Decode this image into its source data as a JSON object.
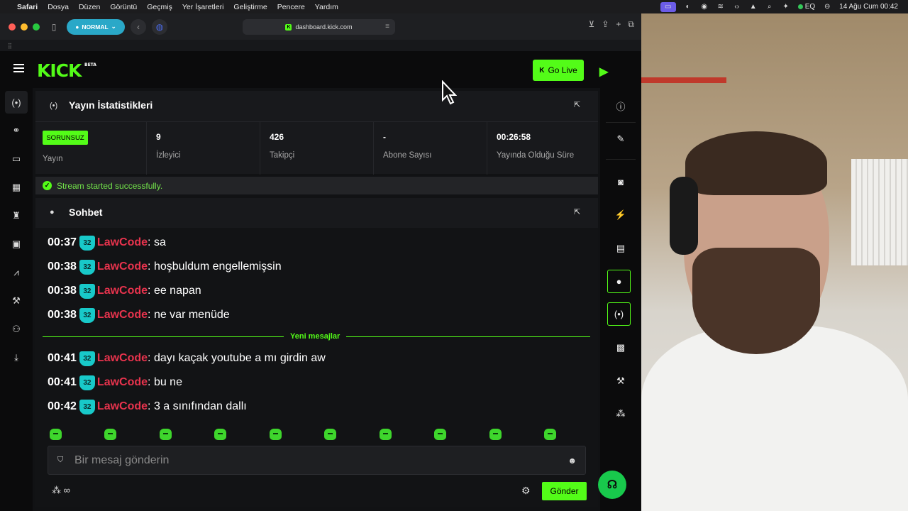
{
  "menubar": {
    "app": "Safari",
    "items": [
      "Dosya",
      "Düzen",
      "Görüntü",
      "Geçmiş",
      "Yer İşaretleri",
      "Geliştirme",
      "Pencere",
      "Yardım"
    ],
    "eq_label": "EQ",
    "datetime": "14 Ağu Cum  00:42"
  },
  "browser": {
    "profile_label": "NORMAL",
    "url": "dashboard.kick.com"
  },
  "header": {
    "logo_text": "KICK",
    "logo_badge": "BETA",
    "go_live_label": "Go Live"
  },
  "stream_stats": {
    "title": "Yayın İstatistikleri",
    "status_badge": "SORUNSUZ",
    "status_label": "Yayın",
    "viewers_value": "9",
    "viewers_label": "İzleyici",
    "followers_value": "426",
    "followers_label": "Takipçi",
    "subs_value": "-",
    "subs_label": "Abone Sayısı",
    "uptime_value": "00:26:58",
    "uptime_label": "Yayında Olduğu Süre",
    "success_message": "Stream started successfully."
  },
  "chat": {
    "title": "Sohbet",
    "messages_before": [
      {
        "time": "00:37",
        "badge": "32",
        "user": "LawCode",
        "text": ": sa"
      },
      {
        "time": "00:38",
        "badge": "32",
        "user": "LawCode",
        "text": ": hoşbuldum engellemişsin"
      },
      {
        "time": "00:38",
        "badge": "32",
        "user": "LawCode",
        "text": ": ee napan"
      },
      {
        "time": "00:38",
        "badge": "32",
        "user": "LawCode",
        "text": ": ne var menüde"
      }
    ],
    "new_messages_label": "Yeni mesajlar",
    "messages_after": [
      {
        "time": "00:41",
        "badge": "32",
        "user": "LawCode",
        "text": ": dayı kaçak youtube a mı girdin aw"
      },
      {
        "time": "00:41",
        "badge": "32",
        "user": "LawCode",
        "text": ": bu ne"
      },
      {
        "time": "00:42",
        "badge": "32",
        "user": "LawCode",
        "text": ": 3 a sınıfından dallı"
      }
    ],
    "input_placeholder": "Bir mesaj gönderin",
    "infinity_label": "∞",
    "send_label": "Gönder"
  },
  "colors": {
    "brand_green": "#53fc18",
    "username_red": "#e8334d",
    "sub_badge_teal": "#18c9c9"
  },
  "icons": {
    "left_nav": [
      "broadcast-icon",
      "link-icon",
      "window-icon",
      "chart-icon",
      "trophy-icon",
      "video-icon",
      "analytics-icon",
      "wrench-icon",
      "users-icon",
      "export-icon"
    ],
    "right_nav": [
      "info-icon",
      "pencil-icon",
      "camera-icon",
      "bolt-icon",
      "note-icon",
      "chat-icon",
      "broadcast-icon",
      "clapper-icon",
      "wrench-icon",
      "dots-icon"
    ]
  }
}
